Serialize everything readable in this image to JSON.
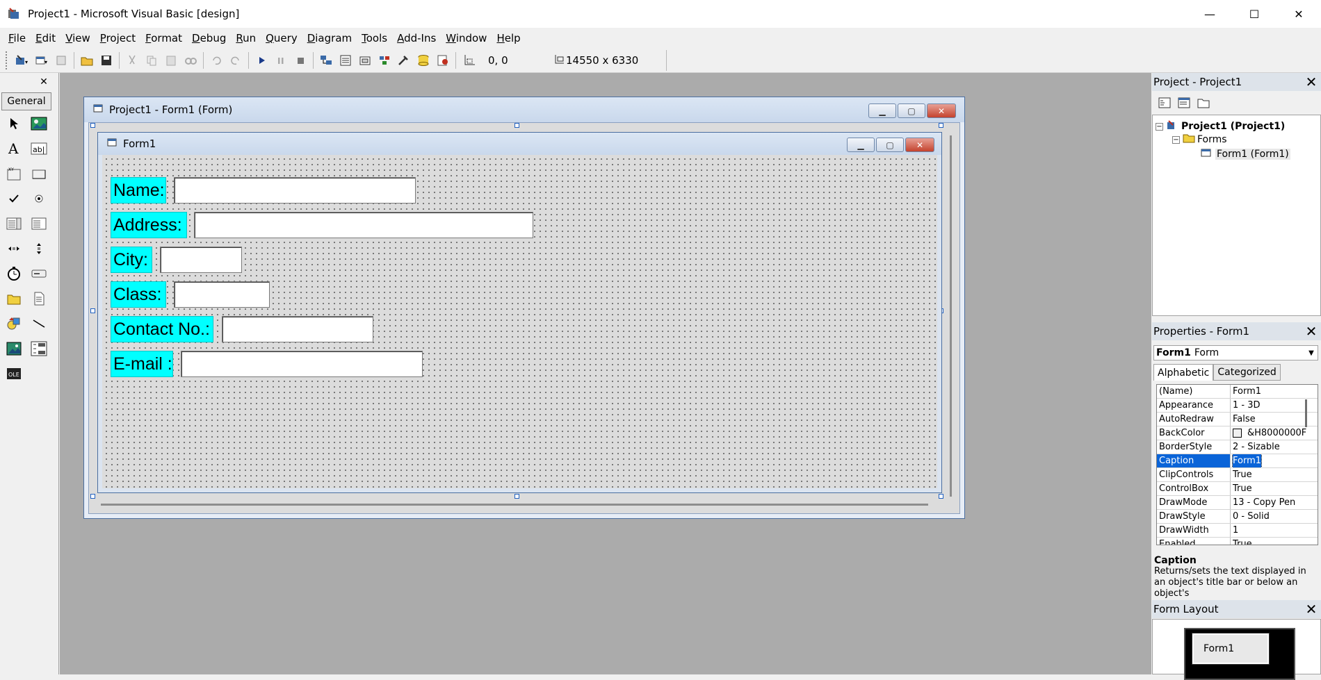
{
  "window": {
    "title": "Project1 - Microsoft Visual Basic [design]",
    "minimize_glyph": "—",
    "maximize_glyph": "☐",
    "close_glyph": "✕"
  },
  "menu": [
    "File",
    "Edit",
    "View",
    "Project",
    "Format",
    "Debug",
    "Run",
    "Query",
    "Diagram",
    "Tools",
    "Add-Ins",
    "Window",
    "Help"
  ],
  "toolbar": {
    "position": "0, 0",
    "size": "14550 x 6330",
    "icons": [
      "add-project-icon",
      "add-form-icon",
      "menu-editor-icon",
      "open-project-icon",
      "save-project-icon",
      "cut-icon",
      "copy-icon",
      "paste-icon",
      "find-icon",
      "undo-icon",
      "redo-icon",
      "start-icon",
      "break-icon",
      "end-icon",
      "project-explorer-icon",
      "properties-window-icon",
      "form-layout-icon",
      "object-browser-icon",
      "toolbox-icon",
      "data-view-icon",
      "component-manager-icon",
      "position-icon",
      "size-icon"
    ]
  },
  "toolbox": {
    "tab": "General",
    "close_glyph": "✕",
    "tools": [
      "pointer",
      "picturebox",
      "label",
      "textbox",
      "frame",
      "commandbutton",
      "checkbox",
      "optionbutton",
      "combobox",
      "listbox",
      "hscrollbar",
      "vscrollbar",
      "timer",
      "drivelistbox",
      "dirlistbox",
      "filelistbox",
      "shape",
      "line",
      "image",
      "data",
      "ole"
    ]
  },
  "designer": {
    "title": "Project1 - Form1 (Form)",
    "form": {
      "caption": "Form1",
      "fields": [
        {
          "label": "Name:"
        },
        {
          "label": "Address:"
        },
        {
          "label": "City:"
        },
        {
          "label": "Class:"
        },
        {
          "label": "Contact No.:"
        },
        {
          "label": "E-mail :"
        }
      ]
    },
    "label_color": "#00FFFF"
  },
  "project_explorer": {
    "title": "Project - Project1",
    "close_glyph": "✕",
    "tree": {
      "project": "Project1 (Project1)",
      "folder": "Forms",
      "item": "Form1 (Form1)"
    }
  },
  "properties": {
    "title": "Properties - Form1",
    "close_glyph": "✕",
    "object_name": "Form1",
    "object_type": "Form",
    "tabs": [
      "Alphabetic",
      "Categorized"
    ],
    "rows": [
      {
        "name": "(Name)",
        "value": "Form1"
      },
      {
        "name": "Appearance",
        "value": "1 - 3D"
      },
      {
        "name": "AutoRedraw",
        "value": "False"
      },
      {
        "name": "BackColor",
        "value": "&H8000000F"
      },
      {
        "name": "BorderStyle",
        "value": "2 - Sizable"
      },
      {
        "name": "Caption",
        "value": "Form1"
      },
      {
        "name": "ClipControls",
        "value": "True"
      },
      {
        "name": "ControlBox",
        "value": "True"
      },
      {
        "name": "DrawMode",
        "value": "13 - Copy Pen"
      },
      {
        "name": "DrawStyle",
        "value": "0 - Solid"
      },
      {
        "name": "DrawWidth",
        "value": "1"
      },
      {
        "name": "Enabled",
        "value": "True"
      }
    ],
    "description_title": "Caption",
    "description_text": "Returns/sets the text displayed in an object's title bar or below an object's"
  },
  "form_layout": {
    "title": "Form Layout",
    "close_glyph": "✕",
    "form_label": "Form1"
  }
}
